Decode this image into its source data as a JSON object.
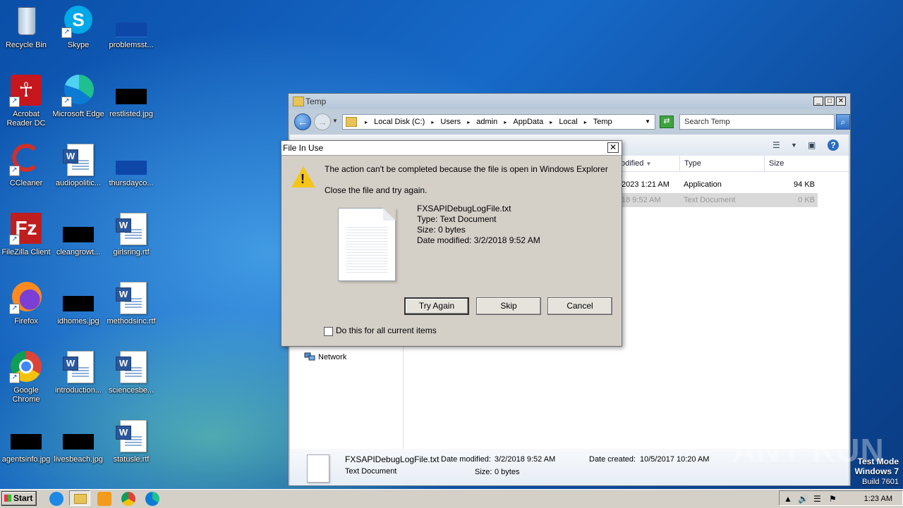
{
  "desktop": {
    "icons": [
      {
        "label": "Recycle Bin"
      },
      {
        "label": "Skype"
      },
      {
        "label": "problemsst..."
      },
      {
        "label": "Acrobat\nReader DC"
      },
      {
        "label": "Microsoft Edge"
      },
      {
        "label": "restlisted.jpg"
      },
      {
        "label": "CCleaner"
      },
      {
        "label": "audiopolitic..."
      },
      {
        "label": "thursdayco..."
      },
      {
        "label": "FileZilla Client"
      },
      {
        "label": "cleangrowt..."
      },
      {
        "label": "girlsring.rtf"
      },
      {
        "label": "Firefox"
      },
      {
        "label": "idhomes.jpg"
      },
      {
        "label": "methodsinc.rtf"
      },
      {
        "label": "Google\nChrome"
      },
      {
        "label": "introduction..."
      },
      {
        "label": "sciencesbe..."
      },
      {
        "label": "agentsinfo.jpg"
      },
      {
        "label": "livesbeach.jpg"
      },
      {
        "label": "statusle.rtf"
      }
    ]
  },
  "explorer": {
    "title": "Temp",
    "breadcrumb": [
      "Local Disk (C:)",
      "Users",
      "admin",
      "AppData",
      "Local",
      "Temp"
    ],
    "search_placeholder": "Search Temp",
    "columns": [
      "odified",
      "Type",
      "Size"
    ],
    "rows": [
      {
        "modified": "2023 1:21 AM",
        "type": "Application",
        "size": "94 KB"
      },
      {
        "modified": "18 9:52 AM",
        "type": "Text Document",
        "size": "0 KB"
      }
    ],
    "nav_network": "Network",
    "details": {
      "name": "FXSAPIDebugLogFile.txt",
      "kind": "Text Document",
      "modified_label": "Date modified:",
      "modified_value": "3/2/2018 9:52 AM",
      "created_label": "Date created:",
      "created_value": "10/5/2017 10:20 AM",
      "size_label": "Size:",
      "size_value": "0 bytes"
    }
  },
  "dialog": {
    "title": "File In Use",
    "message": "The action can't be completed because the file is open in Windows Explorer",
    "instruction": "Close the file and try again.",
    "file_name": "FXSAPIDebugLogFile.txt",
    "file_type": "Type: Text Document",
    "file_size": "Size: 0 bytes",
    "file_modified": "Date modified: 3/2/2018 9:52 AM",
    "buttons": {
      "try_again": "Try Again",
      "skip": "Skip",
      "cancel": "Cancel"
    },
    "checkbox_label": "Do this for all current items"
  },
  "taskbar": {
    "start_label": "Start",
    "clock": "1:23 AM"
  },
  "watermark": "ANY RUN",
  "test_mode": {
    "line1": "Test Mode",
    "line2": "Windows 7",
    "line3": "Build 7601"
  }
}
